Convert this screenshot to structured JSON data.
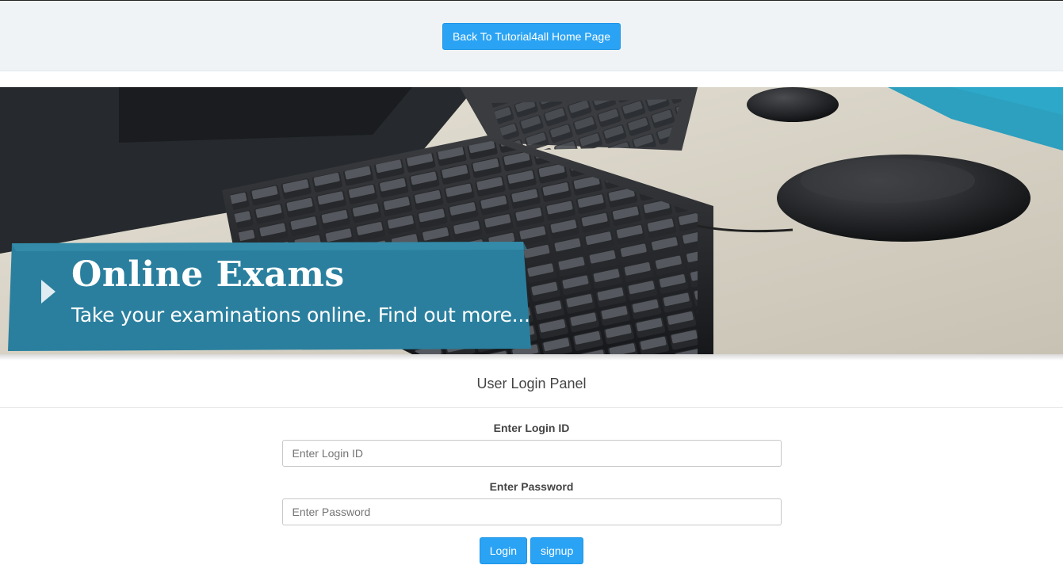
{
  "header": {
    "back_button_label": "Back To Tutorial4all Home Page"
  },
  "banner": {
    "title": "Online Exams",
    "subtitle": "Take your examinations online. Find out more..."
  },
  "panel": {
    "heading": "User Login Panel"
  },
  "form": {
    "login_label": "Enter Login ID",
    "login_placeholder": "Enter Login ID",
    "login_value": "",
    "password_label": "Enter Password",
    "password_placeholder": "Enter Password",
    "password_value": "",
    "login_button": "Login",
    "signup_button": "signup"
  },
  "colors": {
    "accent": "#2aa3f4",
    "banner_ribbon": "#2a7f9e",
    "top_bar_bg": "#eff3f6"
  }
}
